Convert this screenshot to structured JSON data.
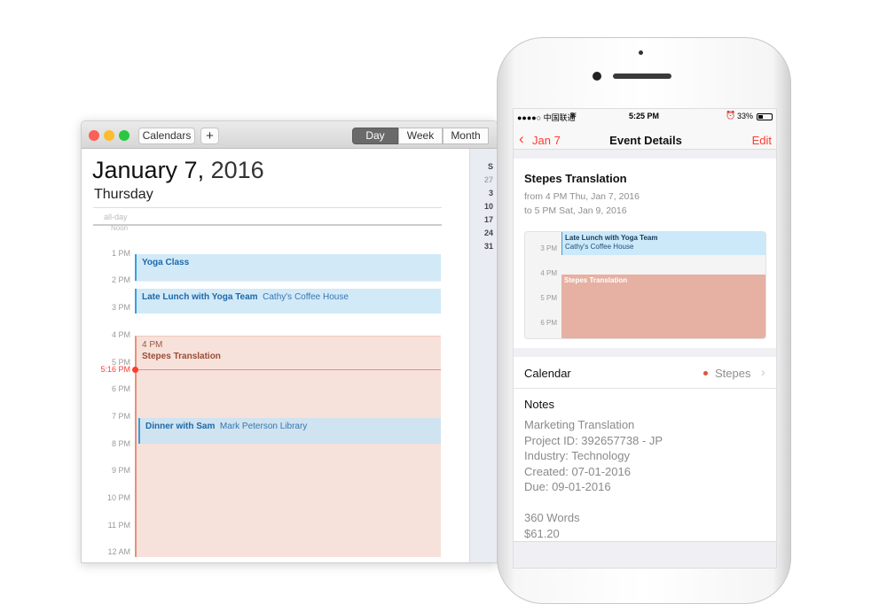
{
  "mac": {
    "toolbar": {
      "calendars": "Calendars",
      "add": "+",
      "views": [
        "Day",
        "Week",
        "Month"
      ]
    },
    "date_bold": "January 7,",
    "date_year": "2016",
    "weekday": "Thursday",
    "allday": "all-day",
    "noon": "Noon",
    "hours": [
      "1 PM",
      "2 PM",
      "3 PM",
      "4 PM",
      "5 PM",
      "6 PM",
      "7 PM",
      "8 PM",
      "9 PM",
      "10 PM",
      "11 PM",
      "12 AM"
    ],
    "now": "5:16 PM",
    "events": {
      "yoga": {
        "title": "Yoga Class"
      },
      "lunch": {
        "title": "Late Lunch with Yoga Team",
        "location": "Cathy's Coffee House"
      },
      "stepes": {
        "time": "4 PM",
        "title": "Stepes Translation"
      },
      "dinner": {
        "title": "Dinner with Sam",
        "location": "Mark Peterson Library"
      }
    },
    "mini_calendar": {
      "header": "S",
      "days": [
        "27",
        "3",
        "10",
        "17",
        "24",
        "31"
      ]
    }
  },
  "phone": {
    "status": {
      "carrier": "●●●●○ 中国联通",
      "time": "5:25 PM",
      "battery": "33%"
    },
    "nav": {
      "back": "Jan 7",
      "title": "Event Details",
      "edit": "Edit"
    },
    "event": {
      "title": "Stepes Translation",
      "from": "from 4 PM Thu, Jan 7, 2016",
      "to": "to 5 PM Sat, Jan 9, 2016"
    },
    "preview": {
      "hours": [
        "3 PM",
        "4 PM",
        "5 PM",
        "6 PM"
      ],
      "lunch_title": "Late Lunch with Yoga Team",
      "lunch_location": "Cathy's Coffee House",
      "stepes_title": "Stepes Translation"
    },
    "calendar": {
      "label": "Calendar",
      "value": "Stepes",
      "color": "#e0533c"
    },
    "notes": {
      "label": "Notes",
      "lines": [
        "Marketing Translation",
        "Project ID: 392657738 - JP",
        "Industry: Technology",
        "Created: 07-01-2016",
        "Due: 09-01-2016",
        "",
        "360 Words",
        "$61.20"
      ]
    }
  },
  "colors": {
    "accent_red": "#ff3b30",
    "event_blue": "#d2e9f8",
    "event_salmon": "#f7e1db",
    "phone_salmon": "#e6b0a2"
  }
}
